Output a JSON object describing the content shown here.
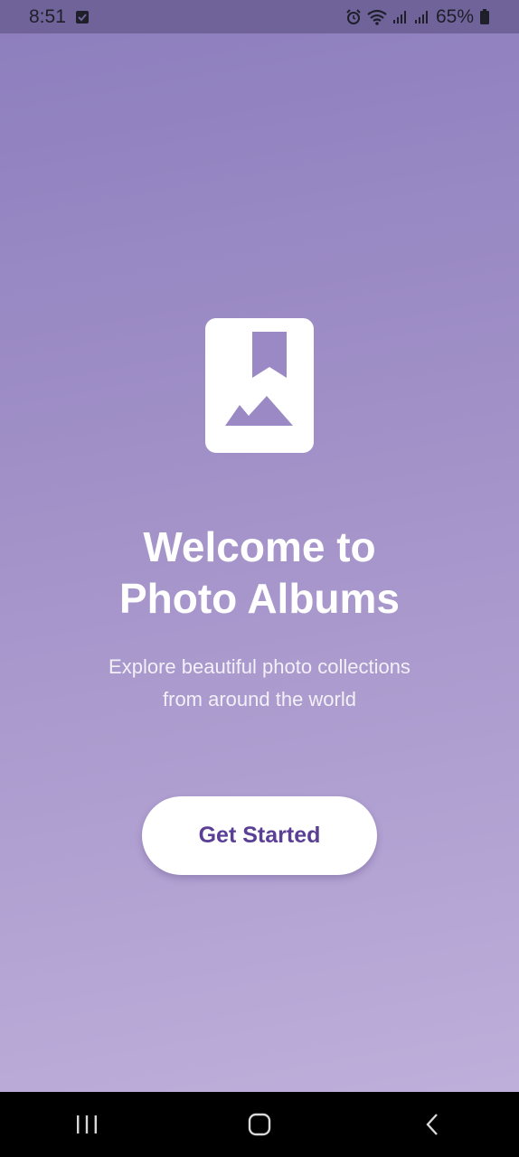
{
  "status_bar": {
    "time": "8:51",
    "battery": "65%",
    "icons": [
      "check-box-icon",
      "alarm-icon",
      "wifi-icon",
      "signal-icon",
      "signal-icon",
      "battery-icon"
    ]
  },
  "welcome": {
    "logo_icon": "bookmark-photo-icon",
    "title_line1": "Welcome to",
    "title_line2": "Photo Albums",
    "subtitle_line1": "Explore beautiful photo collections",
    "subtitle_line2": "from around the world",
    "cta_label": "Get Started"
  },
  "nav_bar": {
    "icons": [
      "recents-icon",
      "home-icon",
      "back-icon"
    ]
  },
  "colors": {
    "gradient_top": "#8c7dbd",
    "gradient_bottom": "#c0b1dc",
    "accent": "#5a3f94",
    "status_bar": "#6f6399"
  }
}
